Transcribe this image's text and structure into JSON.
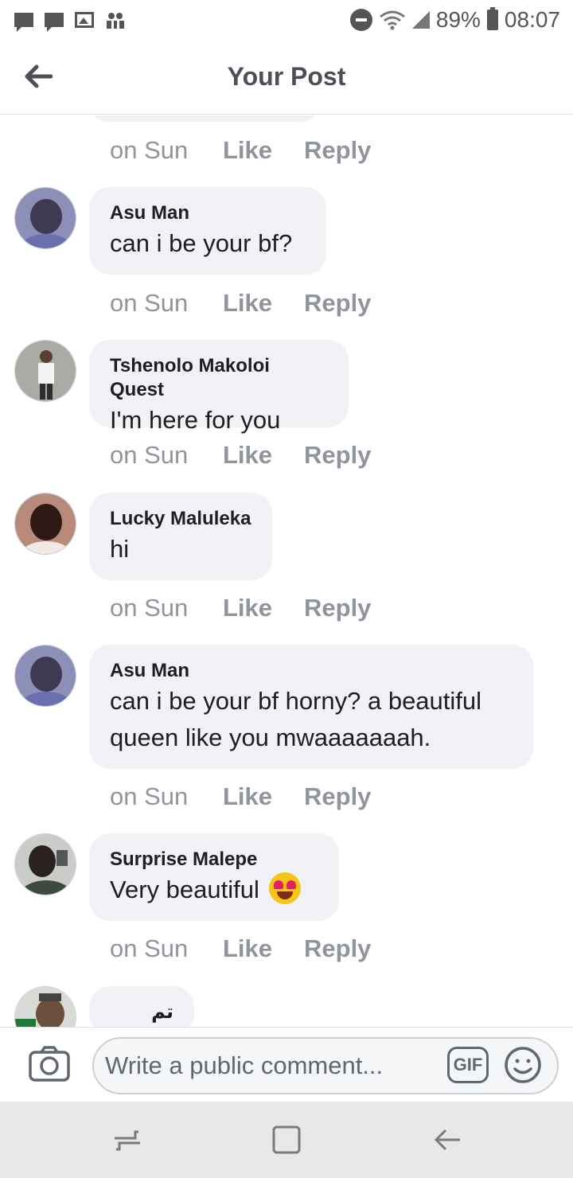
{
  "status_bar": {
    "battery": "89%",
    "time": "08:07",
    "icons": [
      "message-icon",
      "message-icon",
      "image-icon",
      "people-icon",
      "do-not-disturb-icon",
      "wifi-icon",
      "signal-icon",
      "battery-icon"
    ]
  },
  "header": {
    "title": "Your Post",
    "back_icon": "back-arrow-icon"
  },
  "comments": [
    {
      "name": "",
      "text": "",
      "time": "on Sun",
      "like": "Like",
      "reply": "Reply"
    },
    {
      "name": "Asu Man",
      "text": "can i be your bf?",
      "time": "on Sun",
      "like": "Like",
      "reply": "Reply"
    },
    {
      "name": "Tshenolo Makoloi Quest",
      "text": "I'm here for you",
      "time": "on Sun",
      "like": "Like",
      "reply": "Reply"
    },
    {
      "name": "Lucky Maluleka",
      "text": "hi",
      "time": "on Sun",
      "like": "Like",
      "reply": "Reply"
    },
    {
      "name": "Asu Man",
      "text": "can i be your bf horny? a beautiful queen like you mwaaaaaaah.",
      "time": "on Sun",
      "like": "Like",
      "reply": "Reply"
    },
    {
      "name": "Surprise Malepe",
      "text": "Very beautiful",
      "emoji": "heart-eyes-emoji",
      "time": "on Sun",
      "like": "Like",
      "reply": "Reply"
    },
    {
      "name": "تم صرف",
      "text": ""
    }
  ],
  "composer": {
    "placeholder": "Write a public comment...",
    "gif_label": "GIF",
    "camera_icon": "camera-icon",
    "emoji_icon": "smiley-icon"
  },
  "navbar": {
    "icons": [
      "recent-apps-icon",
      "home-icon",
      "back-icon"
    ]
  },
  "colors": {
    "bubble": "#f0f2f5",
    "meta_text": "#90949c",
    "title_text": "#4b4f56"
  }
}
